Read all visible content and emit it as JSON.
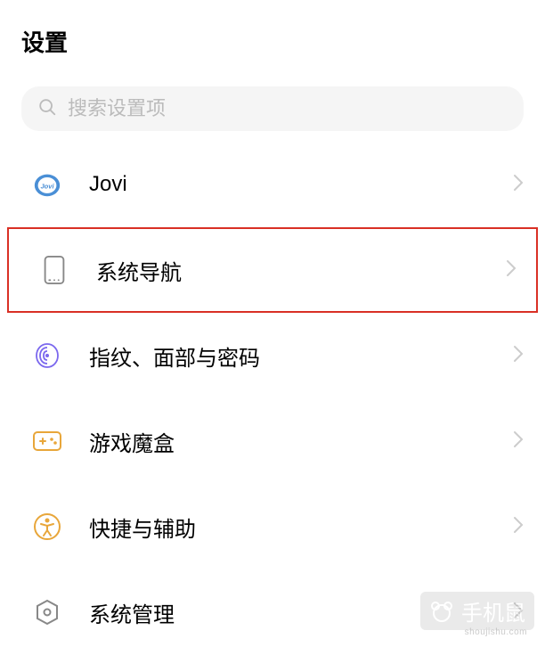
{
  "header": {
    "title": "设置"
  },
  "search": {
    "placeholder": "搜索设置项"
  },
  "items": [
    {
      "icon": "jovi-icon",
      "label": "Jovi",
      "highlighted": false
    },
    {
      "icon": "phone-icon",
      "label": "系统导航",
      "highlighted": true
    },
    {
      "icon": "fingerprint-icon",
      "label": "指纹、面部与密码",
      "highlighted": false
    },
    {
      "icon": "gamebox-icon",
      "label": "游戏魔盒",
      "highlighted": false
    },
    {
      "icon": "accessibility-icon",
      "label": "快捷与辅助",
      "highlighted": false
    },
    {
      "icon": "system-icon",
      "label": "系统管理",
      "highlighted": false
    }
  ],
  "watermark": {
    "text": "手机鼠",
    "sub": "shoujishu.com"
  }
}
